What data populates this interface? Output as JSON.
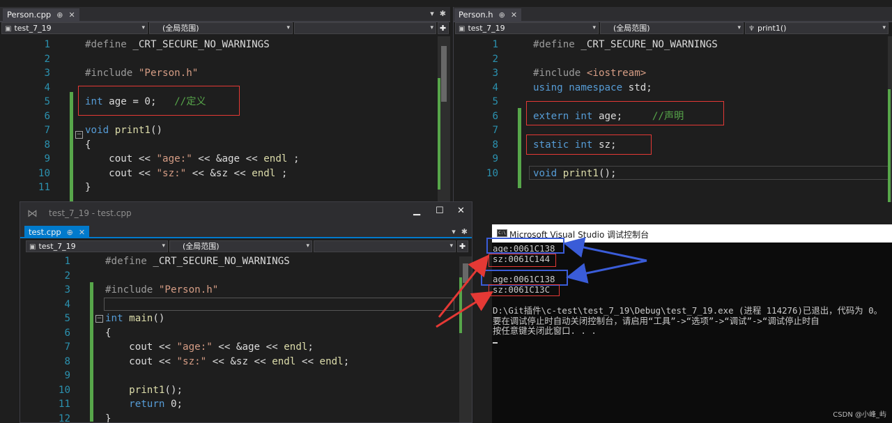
{
  "left_editor": {
    "tab": "Person.cpp",
    "project": "test_7_19",
    "scope": "(全局范围)",
    "lines": [
      {
        "n": "1",
        "parts": [
          [
            "pp",
            "#define"
          ],
          [
            "",
            "_CRT_SECURE_NO_WARNINGS"
          ]
        ]
      },
      {
        "n": "2",
        "parts": []
      },
      {
        "n": "3",
        "parts": [
          [
            "pp",
            "#include"
          ],
          [
            "st",
            "\"Person.h\""
          ]
        ]
      },
      {
        "n": "4",
        "parts": []
      },
      {
        "n": "5",
        "parts": [
          [
            "kw",
            "int"
          ],
          [
            "",
            " age = 0;"
          ],
          [
            "cm",
            "   //定义"
          ]
        ]
      },
      {
        "n": "6",
        "parts": []
      },
      {
        "n": "7",
        "parts": [
          [
            "kw",
            "void"
          ],
          [
            "",
            " "
          ],
          [
            "fn",
            "print1"
          ],
          [
            "",
            "()"
          ]
        ]
      },
      {
        "n": "8",
        "parts": [
          [
            "",
            "{"
          ]
        ]
      },
      {
        "n": "9",
        "parts": [
          [
            "",
            "    cout << "
          ],
          [
            "st",
            "\"age:\""
          ],
          [
            "",
            " << &age << "
          ],
          [
            "fn",
            "endl"
          ],
          [
            "",
            " ;"
          ]
        ]
      },
      {
        "n": "10",
        "parts": [
          [
            "",
            "    cout << "
          ],
          [
            "st",
            "\"sz:\""
          ],
          [
            "",
            " << &sz << "
          ],
          [
            "fn",
            "endl"
          ],
          [
            "",
            " ;"
          ]
        ]
      },
      {
        "n": "11",
        "parts": [
          [
            "",
            "}"
          ]
        ]
      }
    ]
  },
  "right_editor": {
    "tab": "Person.h",
    "project": "test_7_19",
    "scope": "(全局范围)",
    "member": "print1()",
    "lines": [
      {
        "n": "1",
        "parts": [
          [
            "pp",
            "#define"
          ],
          [
            "",
            "_CRT_SECURE_NO_WARNINGS"
          ]
        ]
      },
      {
        "n": "2",
        "parts": []
      },
      {
        "n": "3",
        "parts": [
          [
            "pp",
            "#include"
          ],
          [
            "st",
            "<iostream>"
          ]
        ]
      },
      {
        "n": "4",
        "parts": [
          [
            "kw",
            "using namespace"
          ],
          [
            "",
            " std;"
          ]
        ]
      },
      {
        "n": "5",
        "parts": []
      },
      {
        "n": "6",
        "parts": [
          [
            "kw",
            "extern int"
          ],
          [
            "",
            " age;"
          ],
          [
            "cm",
            "     //声明"
          ]
        ]
      },
      {
        "n": "7",
        "parts": []
      },
      {
        "n": "8",
        "parts": [
          [
            "kw",
            "static int"
          ],
          [
            "",
            " sz;"
          ]
        ]
      },
      {
        "n": "9",
        "parts": []
      },
      {
        "n": "10",
        "parts": [
          [
            "kw",
            "void"
          ],
          [
            "",
            " "
          ],
          [
            "fn",
            "print1"
          ],
          [
            "",
            "();"
          ]
        ]
      }
    ]
  },
  "test_window": {
    "title": "test_7_19 - test.cpp",
    "tab": "test.cpp",
    "project": "test_7_19",
    "scope": "(全局范围)",
    "minimize": "▁",
    "maximize": "☐",
    "close": "✕",
    "lines": [
      {
        "n": "1",
        "parts": [
          [
            "pp",
            "#define"
          ],
          [
            "",
            "_CRT_SECURE_NO_WARNINGS"
          ]
        ]
      },
      {
        "n": "2",
        "parts": []
      },
      {
        "n": "3",
        "parts": [
          [
            "pp",
            "#include"
          ],
          [
            "st",
            "\"Person.h\""
          ]
        ]
      },
      {
        "n": "4",
        "parts": []
      },
      {
        "n": "5",
        "parts": [
          [
            "kw",
            "int"
          ],
          [
            "",
            " "
          ],
          [
            "fn",
            "main"
          ],
          [
            "",
            "()"
          ]
        ]
      },
      {
        "n": "6",
        "parts": [
          [
            "",
            "{"
          ]
        ]
      },
      {
        "n": "7",
        "parts": [
          [
            "",
            "    cout << "
          ],
          [
            "st",
            "\"age:\""
          ],
          [
            "",
            " << &age << "
          ],
          [
            "fn",
            "endl"
          ],
          [
            ";"
          ]
        ]
      },
      {
        "n": "8",
        "parts": [
          [
            "",
            "    cout << "
          ],
          [
            "st",
            "\"sz:\""
          ],
          [
            "",
            " << &sz << "
          ],
          [
            "fn",
            "endl"
          ],
          [
            "",
            " << "
          ],
          [
            "fn",
            "endl"
          ],
          [
            ";"
          ]
        ]
      },
      {
        "n": "9",
        "parts": []
      },
      {
        "n": "10",
        "parts": [
          [
            "",
            "    "
          ],
          [
            "fn",
            "print1"
          ],
          [
            "",
            "();"
          ]
        ]
      },
      {
        "n": "11",
        "parts": [
          [
            "",
            "    "
          ],
          [
            "kw",
            "return"
          ],
          [
            "",
            " 0;"
          ]
        ]
      },
      {
        "n": "12",
        "parts": [
          [
            "",
            "}"
          ]
        ]
      }
    ]
  },
  "console": {
    "icon": "C:\\",
    "title": "Microsoft Visual Studio 调试控制台",
    "lines": [
      "age:0061C138",
      "sz:0061C144",
      "",
      "age:0061C138",
      "sz:0061C13C",
      "",
      "D:\\Git插件\\c-test\\test_7_19\\Debug\\test_7_19.exe (进程 114276)已退出，代码为 0。",
      "要在调试停止时自动关闭控制台，请启用“工具”->“选项”->“调试”->“调试停止时自",
      "按任意键关闭此窗口. . ."
    ]
  },
  "watermark": "CSDN @小峰_屿",
  "colors": {
    "accent": "#007acc",
    "annotation_red": "#e53935",
    "annotation_blue": "#3a5cd8"
  }
}
